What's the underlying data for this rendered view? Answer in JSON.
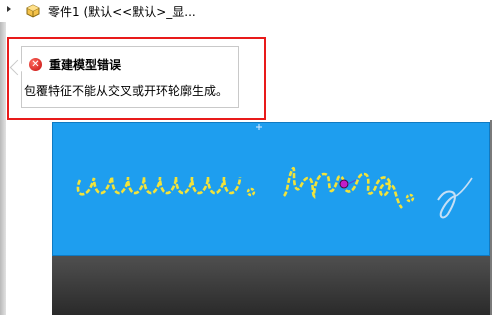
{
  "tree": {
    "part_label": "零件1 (默认<<默认>_显..."
  },
  "error_tooltip": {
    "title": "重建模型错误",
    "message": "包覆特征不能从交叉或开环轮廓生成。"
  },
  "sketch": {
    "text": "www. nbnq."
  },
  "colors": {
    "model_face": "#1e9eef",
    "sketch_line": "#f2e33a",
    "error_frame": "#e81a1a",
    "error_icon": "#c40d0d",
    "selection_point": "#c21ec9"
  }
}
